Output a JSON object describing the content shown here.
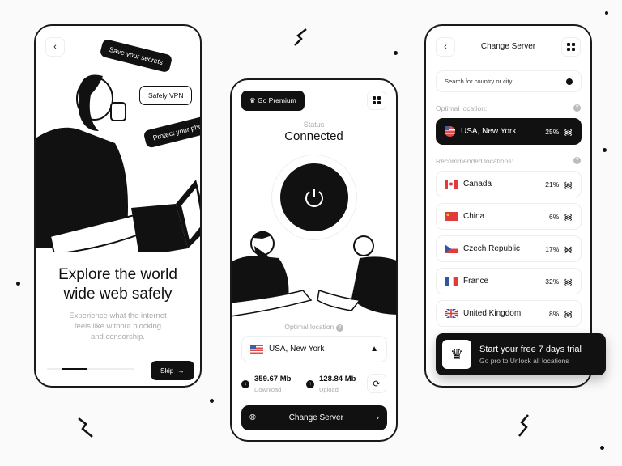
{
  "onboarding": {
    "back": "‹",
    "tags": [
      "Save your secrets",
      "Safely VPN",
      "Protect your pho"
    ],
    "title_line1": "Explore the world",
    "title_line2": "wide web safely",
    "subtitle_lines": [
      "Experience what the internet",
      "feels like without blocking",
      "and censorship."
    ],
    "skip_label": "Skip",
    "progress_step": 2
  },
  "home": {
    "premium_label": "Go Premium",
    "status_label": "Status",
    "status_value": "Connected",
    "optimal_label": "Optimal location",
    "location": "USA, New York",
    "download_value": "359.67 Mb",
    "download_label": "Download",
    "upload_value": "128.84 Mb",
    "upload_label": "Upload",
    "change_server_label": "Change Server"
  },
  "server": {
    "title": "Change Server",
    "search_placeholder": "Search for country or city",
    "optimal_label": "Optimal location:",
    "optimal": {
      "name": "USA, New York",
      "load": "25%"
    },
    "recommended_label": "Recommended locations:",
    "locations": [
      {
        "name": "Canada",
        "load": "21%",
        "flag": "ca"
      },
      {
        "name": "China",
        "load": "6%",
        "flag": "cn"
      },
      {
        "name": "Czech Republic",
        "load": "17%",
        "flag": "cz"
      },
      {
        "name": "France",
        "load": "32%",
        "flag": "fr"
      },
      {
        "name": "United Kingdom",
        "load": "8%",
        "flag": "gb"
      }
    ]
  },
  "trial": {
    "title": "Start your free 7 days trial",
    "subtitle": "Go pro to Unlock all locations"
  },
  "colors": {
    "dark": "#111111",
    "muted": "#aaaaaa"
  }
}
